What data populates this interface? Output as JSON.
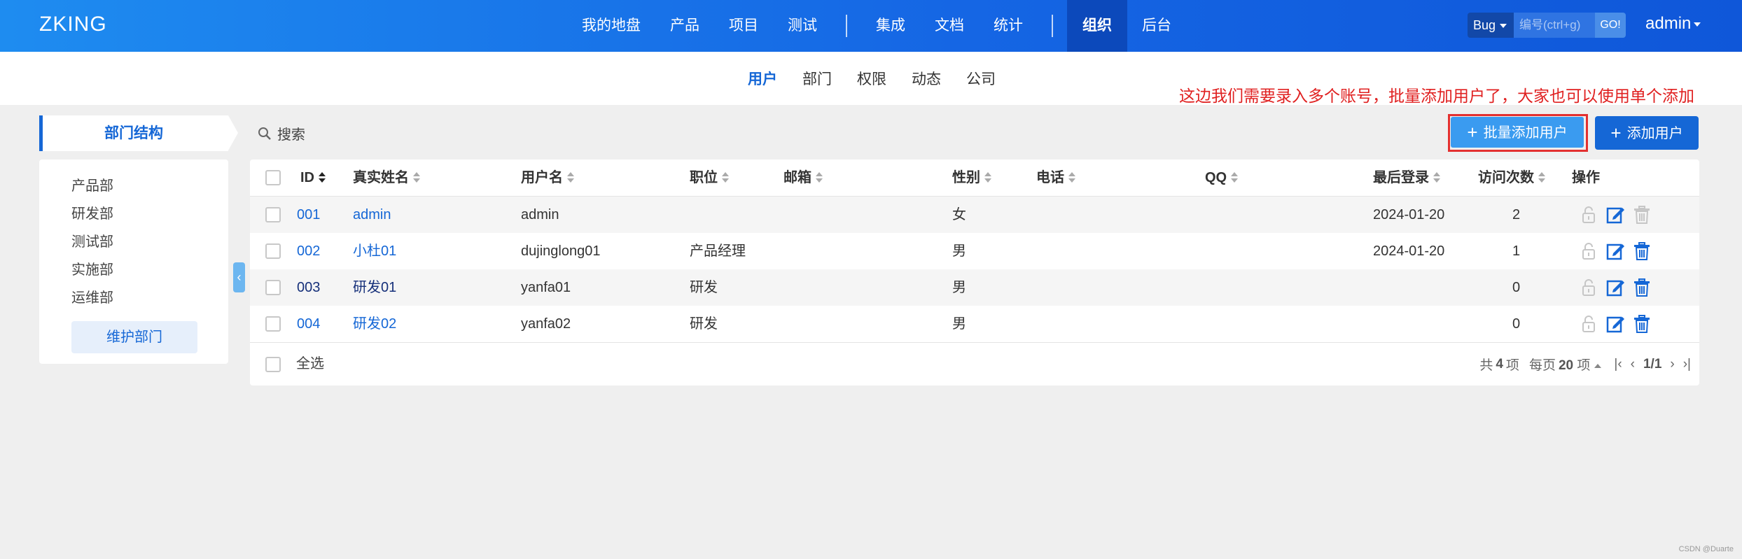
{
  "header": {
    "brand": "ZKING",
    "nav": [
      {
        "label": "我的地盘"
      },
      {
        "label": "产品"
      },
      {
        "label": "项目"
      },
      {
        "label": "测试"
      },
      {
        "label": "集成"
      },
      {
        "label": "文档"
      },
      {
        "label": "统计"
      },
      {
        "label": "组织",
        "active": true
      },
      {
        "label": "后台"
      }
    ],
    "search": {
      "type": "Bug",
      "placeholder": "编号(ctrl+g)",
      "go": "GO!"
    },
    "user": "admin"
  },
  "subnav": {
    "tabs": [
      {
        "label": "用户",
        "active": true
      },
      {
        "label": "部门"
      },
      {
        "label": "权限"
      },
      {
        "label": "动态"
      },
      {
        "label": "公司"
      }
    ]
  },
  "annotation": "这边我们需要录入多个账号，批量添加用户了，大家也可以使用单个添加",
  "sidebar": {
    "title": "部门结构",
    "departments": [
      "产品部",
      "研发部",
      "测试部",
      "实施部",
      "运维部"
    ],
    "maintain_button": "维护部门"
  },
  "toolbar": {
    "search_label": "搜索",
    "batch_add": "批量添加用户",
    "add_user": "添加用户"
  },
  "table": {
    "columns": [
      "ID",
      "真实姓名",
      "用户名",
      "职位",
      "邮箱",
      "性别",
      "电话",
      "QQ",
      "最后登录",
      "访问次数",
      "操作"
    ],
    "rows": [
      {
        "id": "001",
        "realname": "admin",
        "username": "admin",
        "role": "",
        "email": "",
        "gender": "女",
        "phone": "",
        "qq": "",
        "last_login": "2024-01-20",
        "visits": "2"
      },
      {
        "id": "002",
        "realname": "小杜01",
        "username": "dujinglong01",
        "role": "产品经理",
        "email": "",
        "gender": "男",
        "phone": "",
        "qq": "",
        "last_login": "2024-01-20",
        "visits": "1"
      },
      {
        "id": "003",
        "realname": "研发01",
        "username": "yanfa01",
        "role": "研发",
        "email": "",
        "gender": "男",
        "phone": "",
        "qq": "",
        "last_login": "",
        "visits": "0"
      },
      {
        "id": "004",
        "realname": "研发02",
        "username": "yanfa02",
        "role": "研发",
        "email": "",
        "gender": "男",
        "phone": "",
        "qq": "",
        "last_login": "",
        "visits": "0"
      }
    ],
    "select_all": "全选"
  },
  "pager": {
    "total_prefix": "共",
    "total": "4",
    "total_suffix": "项",
    "per_page_prefix": "每页",
    "per_page": "20",
    "per_page_suffix": "项",
    "page": "1/1"
  },
  "watermark": "CSDN @Duarte",
  "colors": {
    "primary": "#1567d6",
    "header": "#1e8cf0",
    "highlight": "#e33030"
  }
}
